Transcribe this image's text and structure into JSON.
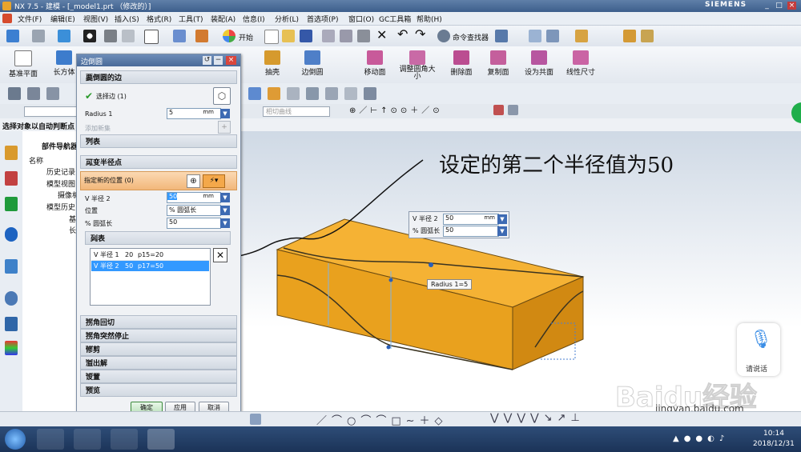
{
  "titlebar": {
    "app": "NX 7.5 - 建模 - [_model1.prt （修改的）]",
    "brand": "SIEMENS"
  },
  "menu": [
    "文件(F)",
    "编辑(E)",
    "视图(V)",
    "插入(S)",
    "格式(R)",
    "工具(T)",
    "装配(A)",
    "信息(I)",
    "分析(L)",
    "首选项(P)",
    "窗口(O)",
    "GC工具箱",
    "帮助(H)"
  ],
  "toolbar1": {
    "start_label": "开始",
    "cmd_finder": "命令查找器"
  },
  "toolbar2": {
    "items": [
      "基准平面",
      "长方体",
      "抽壳",
      "边倒圆",
      "移动面",
      "调整圆角大小",
      "删除面",
      "复制面",
      "设为共面",
      "线性尺寸"
    ]
  },
  "toolbar3": {
    "filter": "相切曲线"
  },
  "status": {
    "prompt": "选择对象以自动判断点"
  },
  "nav": {
    "title": "部件导航器",
    "col_name": "名称",
    "items": [
      "历史记录",
      "模型视图",
      "摄像机",
      "模型历史",
      "基",
      "长"
    ]
  },
  "dialog": {
    "title": "边倒圆",
    "sec1": "要倒圆的边",
    "select_edge": "选择边 (1)",
    "radius_label": "Radius 1",
    "radius_value": "5",
    "radius_unit": "mm",
    "add_set": "添加新集",
    "list1": "列表",
    "sec2": "可变半径点",
    "specify_pos": "指定新的位置 (0)",
    "v_radius_label": "V 半径 2",
    "v_radius_value": "50",
    "v_unit": "mm",
    "position_label": "位置",
    "position_value": "% 圆弧长",
    "arc_label": "% 圆弧长",
    "arc_value": "50",
    "list2": "列表",
    "rows": [
      {
        "name": "V 半径 1",
        "v": "20",
        "p": "p15=20"
      },
      {
        "name": "V 半径 2",
        "v": "50",
        "p": "p17=50"
      }
    ],
    "sections": [
      "拐角回切",
      "拐角突然停止",
      "修剪",
      "溢出解",
      "设置",
      "预览"
    ],
    "ok": "确定",
    "apply": "应用",
    "cancel": "取消"
  },
  "popup": {
    "v_radius_label": "V 半径 2",
    "v_radius_value": "50",
    "unit": "mm",
    "arc_label": "% 圆弧长",
    "arc_value": "50"
  },
  "viewport_label": "Radius 1=5",
  "annotation": "设定的第二个半径值为50",
  "voice": {
    "label": "请说话"
  },
  "watermark": {
    "main": "Baidu经验",
    "sub": "jingyan.baidu.com"
  },
  "taskbar": {
    "time": "10:14",
    "date": "2018/12/31"
  },
  "colors": {
    "part": "#f5a623",
    "selected_row": "#3399ff",
    "title_blue": "#4a6b99"
  }
}
